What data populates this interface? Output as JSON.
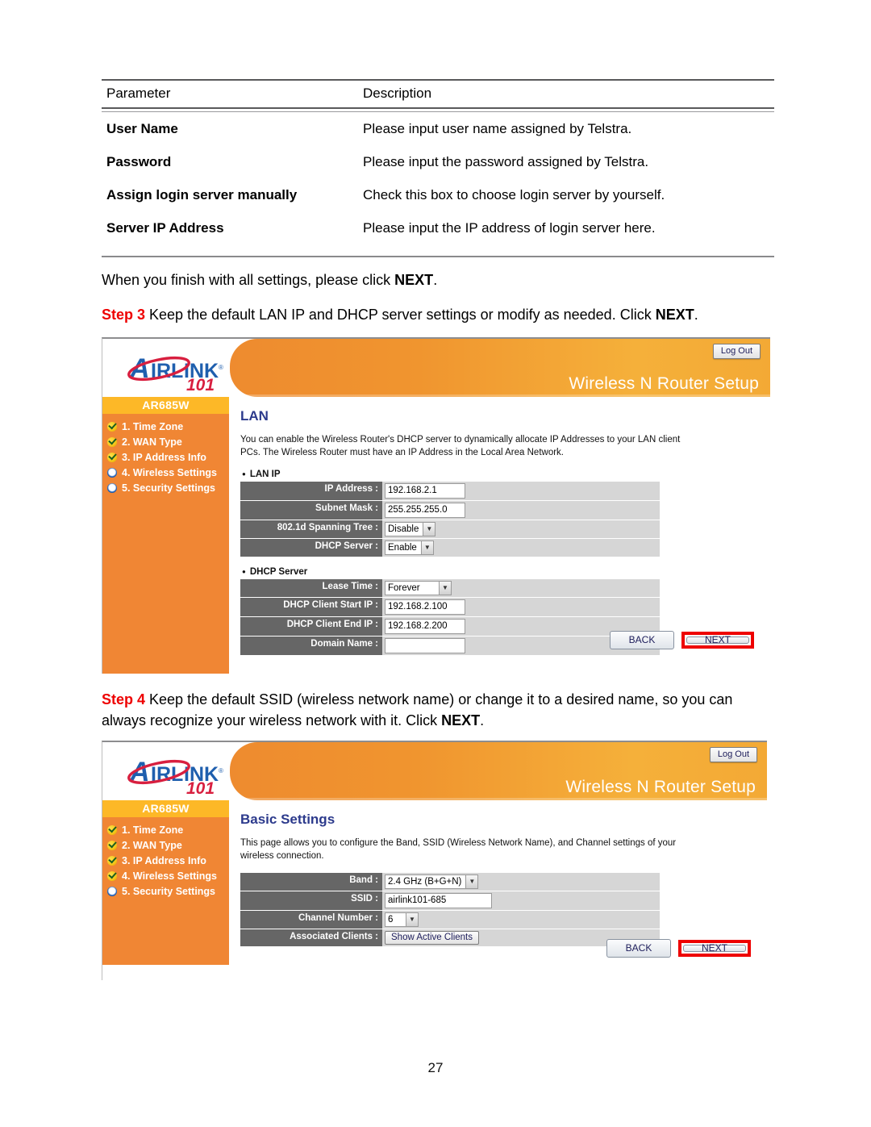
{
  "param_table": {
    "headers": [
      "Parameter",
      "Description"
    ],
    "rows": [
      {
        "parameter": "User Name",
        "description": "Please input user name assigned by Telstra."
      },
      {
        "parameter": "Password",
        "description": "Please input the password assigned by Telstra."
      },
      {
        "parameter": "Assign login server manually",
        "description": "Check this box to choose login server by yourself."
      },
      {
        "parameter": "Server IP Address",
        "description": "Please input the IP address of login server here."
      }
    ]
  },
  "paragraphs": {
    "finish_prefix": "When you finish with all settings, please click ",
    "finish_bold": "NEXT",
    "finish_suffix": ".",
    "step3_label": "Step 3",
    "step3_text": " Keep the default LAN IP and DHCP server settings or modify as needed. Click ",
    "step3_bold": "NEXT",
    "step3_suffix": ".",
    "step4_label": "Step 4",
    "step4_text": " Keep the default SSID (wireless network name) or change it to a desired name, so you can always recognize your wireless network with it. Click ",
    "step4_bold": "NEXT",
    "step4_suffix": "."
  },
  "router_common": {
    "brand": "AIRLINK",
    "brand_sub": "101",
    "model": "AR685W",
    "header_title": "Wireless N Router Setup",
    "logout_label": "Log Out",
    "back_label": "BACK",
    "next_label": "NEXT",
    "accent_orange": "#f08634",
    "accent_amber": "#fdb827",
    "highlight_red": "#ee0000",
    "panel_title_blue": "#2c3a8c"
  },
  "shot_lan": {
    "nav": [
      {
        "label": "1. Time Zone",
        "state": "done"
      },
      {
        "label": "2. WAN Type",
        "state": "done"
      },
      {
        "label": "3. IP Address Info",
        "state": "done"
      },
      {
        "label": "4. Wireless Settings",
        "state": "todo"
      },
      {
        "label": "5. Security Settings",
        "state": "todo"
      }
    ],
    "panel_title": "LAN",
    "panel_desc": "You can enable the Wireless Router's DHCP server to dynamically allocate IP Addresses to your LAN client PCs. The Wireless Router must have an IP Address in the Local Area Network.",
    "section_lan_ip": "LAN IP",
    "section_dhcp": "DHCP Server",
    "fields": {
      "ip_address_label": "IP Address :",
      "ip_address_value": "192.168.2.1",
      "subnet_mask_label": "Subnet Mask :",
      "subnet_mask_value": "255.255.255.0",
      "spanning_tree_label": "802.1d Spanning Tree :",
      "spanning_tree_value": "Disable",
      "dhcp_server_label": "DHCP Server :",
      "dhcp_server_value": "Enable",
      "lease_time_label": "Lease Time :",
      "lease_time_value": "Forever",
      "dhcp_start_label": "DHCP Client Start IP :",
      "dhcp_start_value": "192.168.2.100",
      "dhcp_end_label": "DHCP Client End IP :",
      "dhcp_end_value": "192.168.2.200",
      "domain_name_label": "Domain Name :",
      "domain_name_value": ""
    }
  },
  "shot_basic": {
    "nav": [
      {
        "label": "1. Time Zone",
        "state": "done"
      },
      {
        "label": "2. WAN Type",
        "state": "done"
      },
      {
        "label": "3. IP Address Info",
        "state": "done"
      },
      {
        "label": "4. Wireless Settings",
        "state": "done"
      },
      {
        "label": "5. Security Settings",
        "state": "todo"
      }
    ],
    "panel_title": "Basic Settings",
    "panel_desc": "This page allows you to configure the Band, SSID (Wireless Network Name), and Channel settings of your wireless connection.",
    "fields": {
      "band_label": "Band :",
      "band_value": "2.4 GHz (B+G+N)",
      "ssid_label": "SSID :",
      "ssid_value": "airlink101-685",
      "channel_label": "Channel Number :",
      "channel_value": "6",
      "clients_label": "Associated Clients :",
      "clients_button": "Show Active Clients"
    }
  },
  "footer": {
    "page_number": "27"
  }
}
